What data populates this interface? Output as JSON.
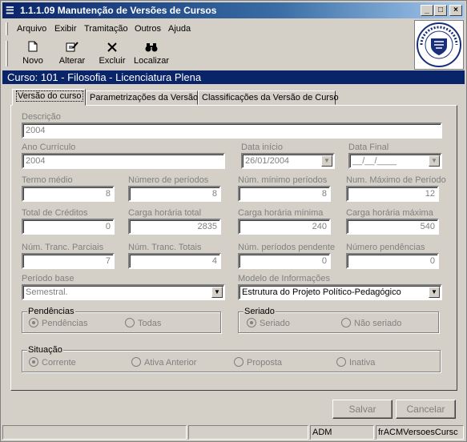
{
  "window": {
    "title": "1.1.1.09 Manutenção de Versões de Cursos",
    "minimize": "_",
    "maximize": "□",
    "close": "×"
  },
  "menu": [
    "Arquivo",
    "Exibir",
    "Tramitação",
    "Outros",
    "Ajuda"
  ],
  "toolbar": {
    "novo": "Novo",
    "alterar": "Alterar",
    "excluir": "Excluir",
    "localizar": "Localizar"
  },
  "curso_header": "Curso: 101 - Filosofia - Licenciatura Plena",
  "tabs": [
    "Versão do curso",
    "Parametrizações da Versão",
    "Classificações da Versão de Curso"
  ],
  "form": {
    "descricao_label": "Descrição",
    "descricao_value": "2004",
    "ano_label": "Ano Currículo",
    "ano_value": "2004",
    "data_inicio_label": "Data início",
    "data_inicio_value": "26/01/2004",
    "data_final_label": "Data Final",
    "data_final_value": "__/__/____",
    "termo_label": "Termo médio",
    "termo_value": "8",
    "num_periodos_label": "Número de períodos",
    "num_periodos_value": "8",
    "min_periodos_label": "Núm. mínimo períodos",
    "min_periodos_value": "8",
    "max_periodos_label": "Num. Máximo de Período",
    "max_periodos_value": "12",
    "creditos_label": "Total de Créditos",
    "creditos_value": "0",
    "ch_total_label": "Carga horária total",
    "ch_total_value": "2835",
    "ch_min_label": "Carga horária mínima",
    "ch_min_value": "240",
    "ch_max_label": "Carga horária máxima",
    "ch_max_value": "540",
    "tranc_parc_label": "Núm. Tranc. Parciais",
    "tranc_parc_value": "7",
    "tranc_tot_label": "Núm. Tranc. Totais",
    "tranc_tot_value": "4",
    "periodos_pend_label": "Núm. períodos pendente",
    "periodos_pend_value": "0",
    "num_pend_label": "Número pendências",
    "num_pend_value": "0",
    "periodo_base_label": "Período base",
    "periodo_base_value": "Semestral.",
    "modelo_label": "Modelo de Informações",
    "modelo_value": "Estrutura do Projeto Político-Pedagógico"
  },
  "pendencias": {
    "title": "Pendências",
    "opt1": "Pendências",
    "opt2": "Todas"
  },
  "seriado": {
    "title": "Seriado",
    "opt1": "Seriado",
    "opt2": "Não seriado"
  },
  "situacao": {
    "title": "Situação",
    "opt1": "Corrente",
    "opt2": "Ativa Anterior",
    "opt3": "Proposta",
    "opt4": "Inativa"
  },
  "buttons": {
    "salvar": "Salvar",
    "cancelar": "Cancelar"
  },
  "statusbar": {
    "user": "ADM",
    "form": "frACMVersoesCursc"
  }
}
